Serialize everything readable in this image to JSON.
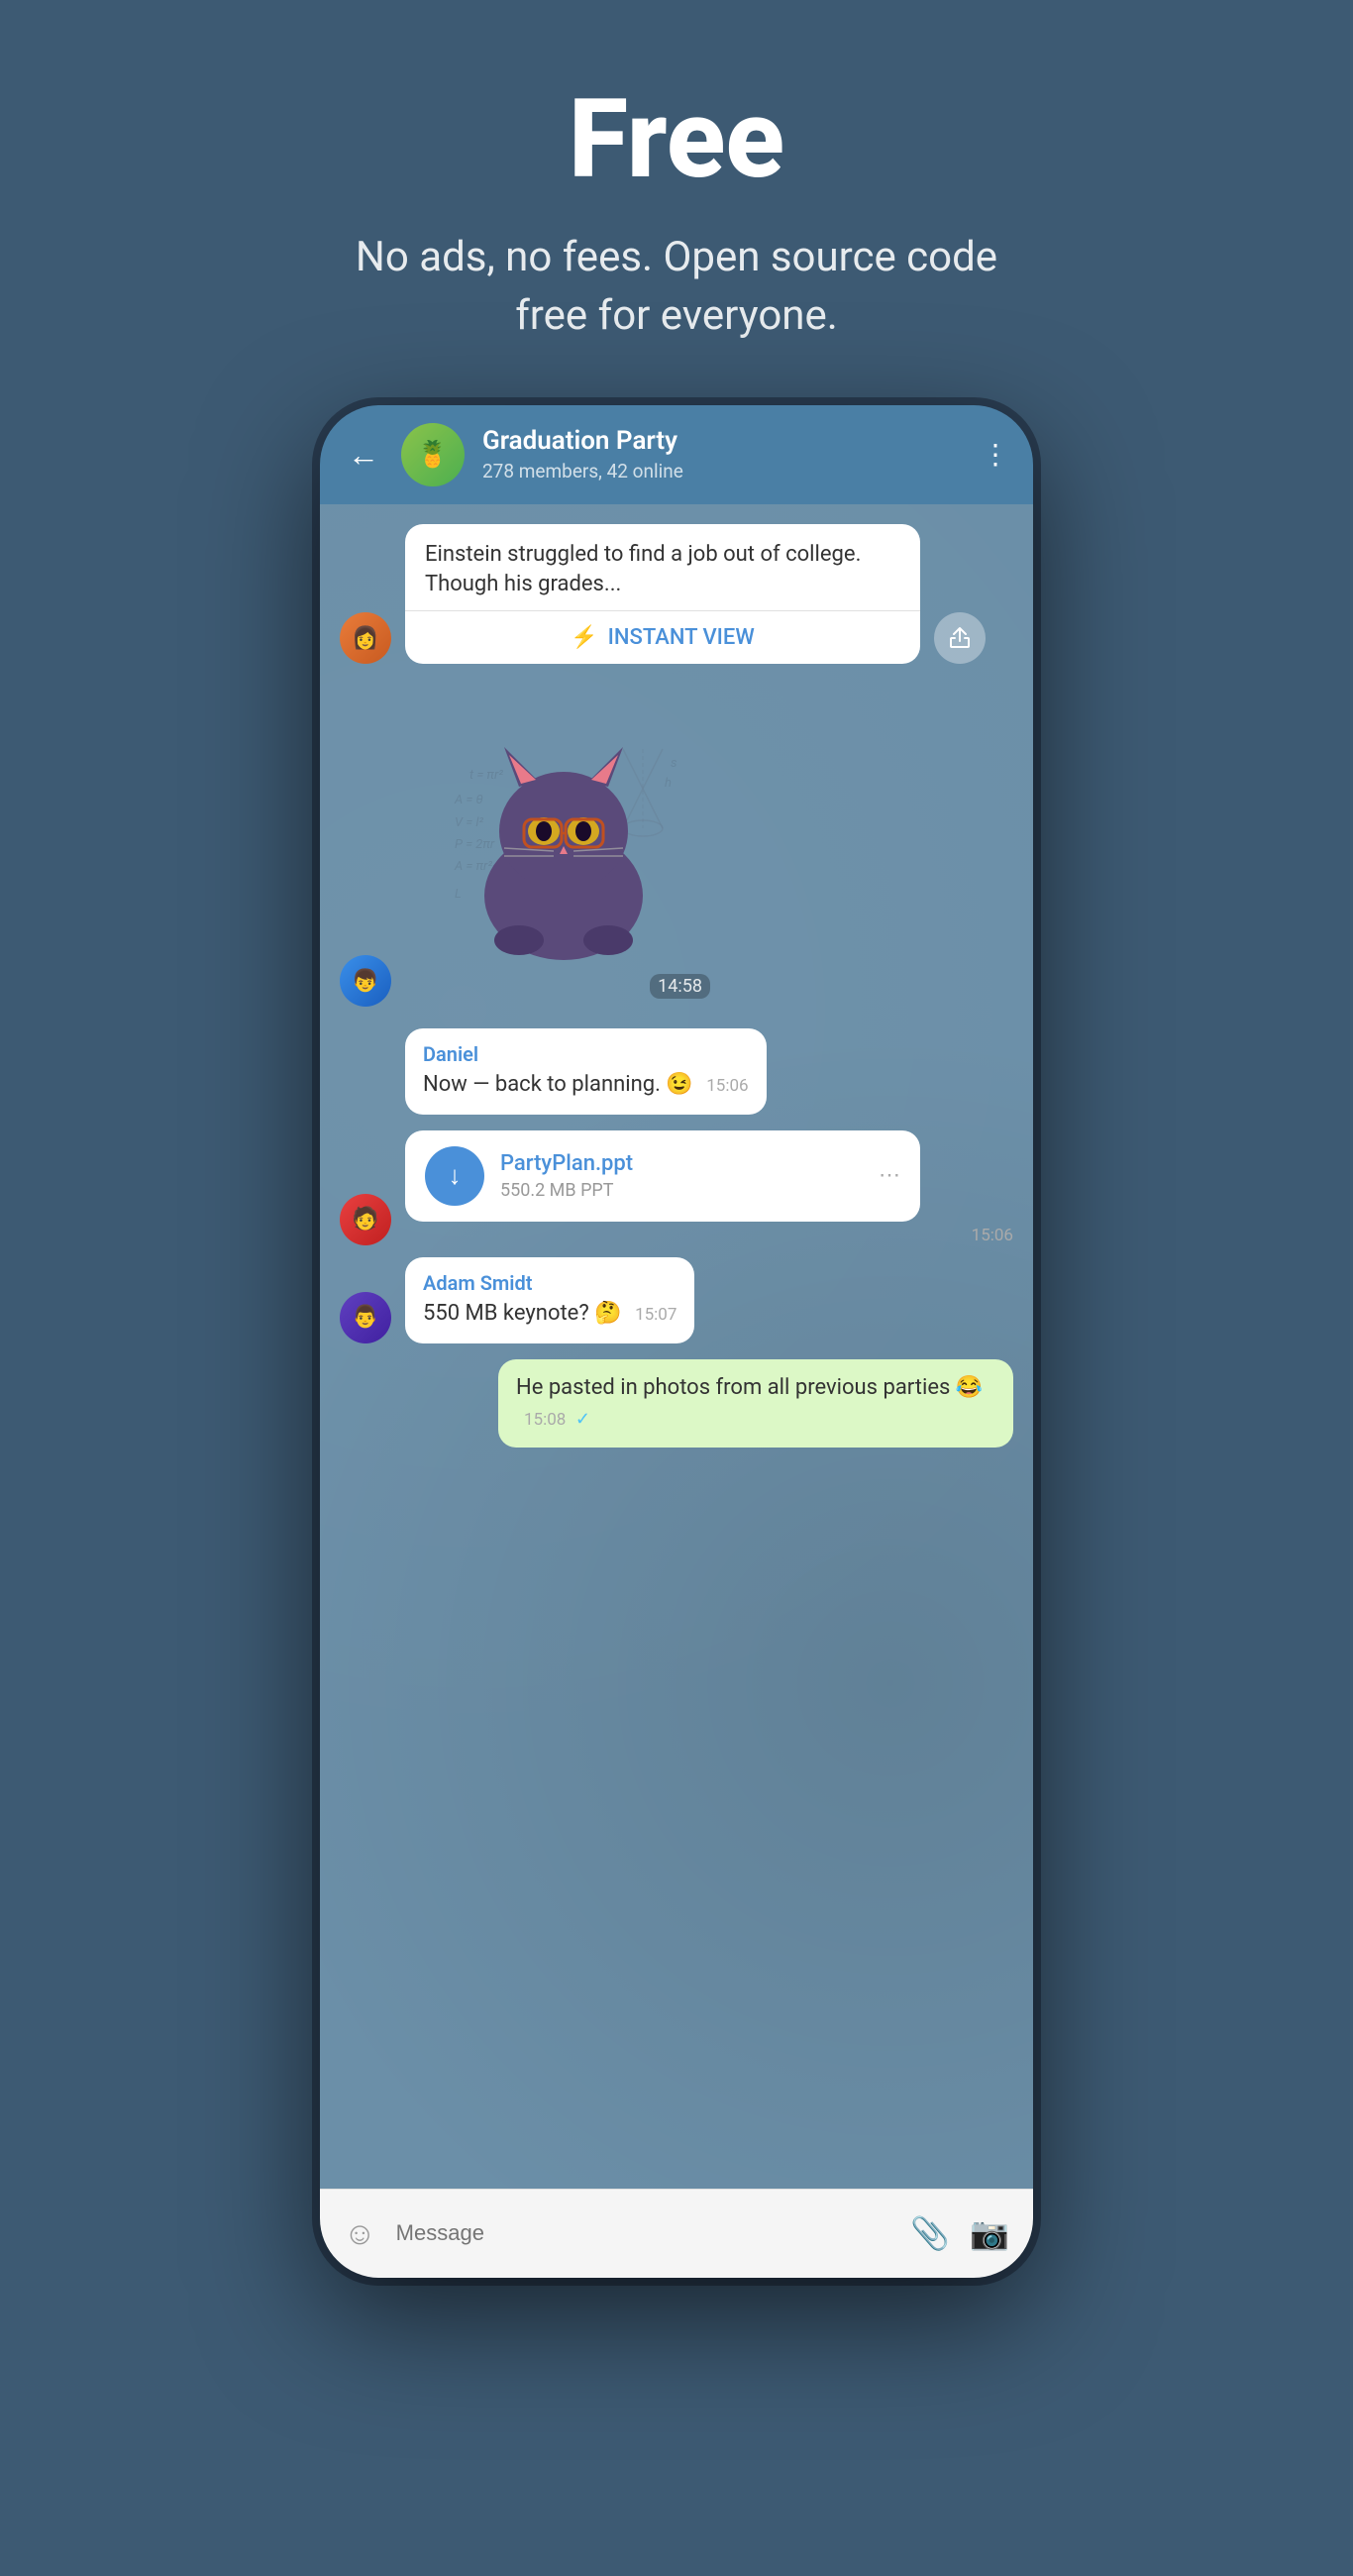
{
  "hero": {
    "title": "Free",
    "subtitle": "No ads, no fees. Open source code free for everyone."
  },
  "phone": {
    "header": {
      "back_label": "←",
      "group_name": "Graduation Party",
      "group_members": "278 members, 42 online",
      "more_icon": "⋮"
    },
    "messages": [
      {
        "type": "article",
        "text": "Einstein struggled to find a job out of college. Though his grades...",
        "instant_view_label": "INSTANT VIEW",
        "avatar_type": "girl"
      },
      {
        "type": "sticker",
        "time": "14:58",
        "avatar_type": "guy1"
      },
      {
        "type": "text",
        "sender": "Daniel",
        "text": "Now — back to planning. 😉",
        "time": "15:06",
        "avatar_type": "guy1"
      },
      {
        "type": "file",
        "sender": "PartyPlan.ppt",
        "size": "550.2 MB PPT",
        "time": "15:06",
        "avatar_type": "guy2"
      },
      {
        "type": "text",
        "sender": "Adam Smidt",
        "text": "550 MB keynote? 🤔",
        "time": "15:07",
        "avatar_type": "guy3"
      },
      {
        "type": "own",
        "text": "He pasted in photos from all previous parties 😂",
        "time": "15:08",
        "checkmark": "✓"
      }
    ],
    "input": {
      "placeholder": "Message",
      "emoji_icon": "☺",
      "attach_icon": "📎",
      "camera_icon": "📷"
    }
  }
}
